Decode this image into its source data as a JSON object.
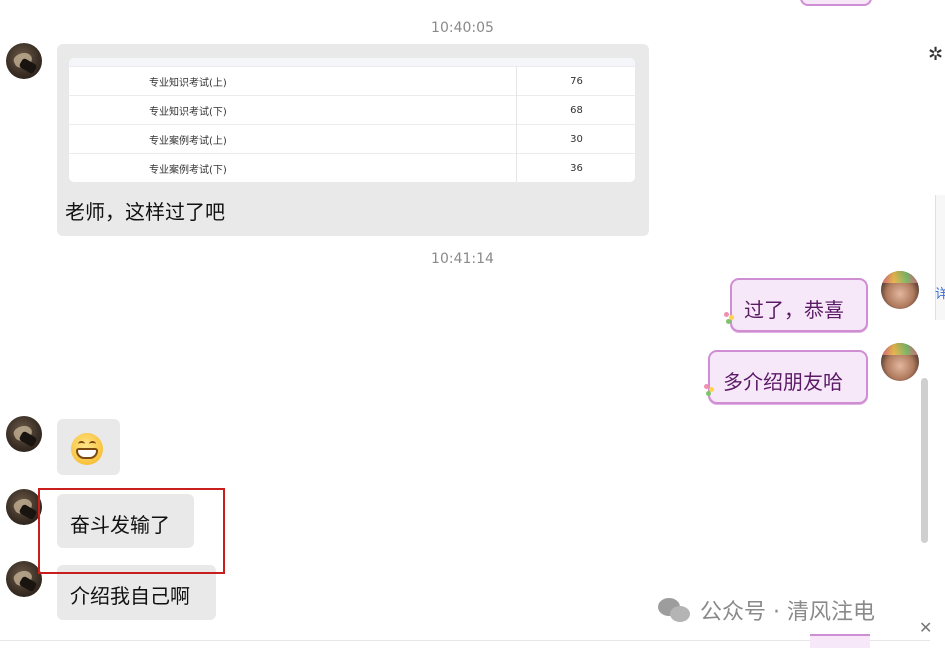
{
  "timestamps": [
    "10:40:05",
    "10:41:14"
  ],
  "score_table": {
    "rows": [
      {
        "subject": "专业知识考试(上)",
        "score": "76"
      },
      {
        "subject": "专业知识考试(下)",
        "score": "68"
      },
      {
        "subject": "专业案例考试(上)",
        "score": "30"
      },
      {
        "subject": "专业案例考试(下)",
        "score": "36"
      }
    ]
  },
  "messages": {
    "left_1_caption": "老师，这样过了吧",
    "right_1": "过了，恭喜",
    "right_2": "多介绍朋友哈",
    "left_2_emoji": "grinning-face",
    "left_3": "奋斗发输了",
    "left_4": "介绍我自己啊"
  },
  "watermark": {
    "text": "公众号 · 清风注电"
  },
  "edge": {
    "partial_text": "详"
  },
  "colors": {
    "left_bubble": "#e9e9e9",
    "right_bubble_bg": "#f6e8f8",
    "right_bubble_border": "#cf8ed3",
    "right_bubble_text": "#5b1a66",
    "highlight": "#c81e1e"
  }
}
